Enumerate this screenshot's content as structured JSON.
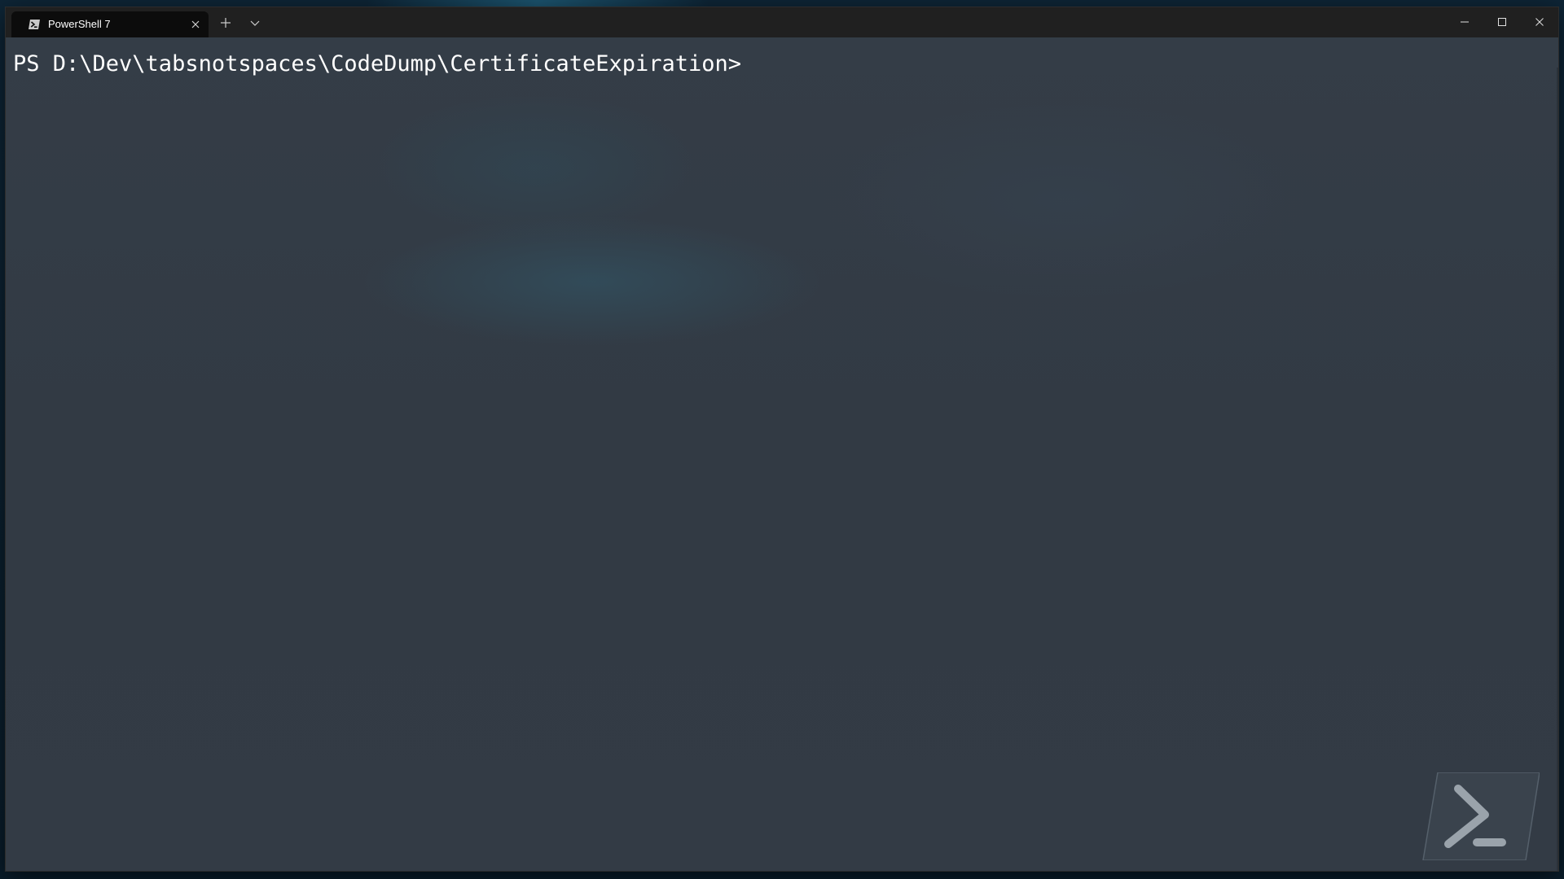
{
  "window": {
    "tab": {
      "title": "PowerShell 7",
      "icon": "powershell-icon",
      "close_icon": "close-icon"
    },
    "new_tab_icon": "plus-icon",
    "dropdown_icon": "chevron-down-icon",
    "controls": {
      "minimize_icon": "minimize-icon",
      "maximize_icon": "maximize-icon",
      "close_icon": "close-icon"
    }
  },
  "terminal": {
    "prompt": "PS D:\\Dev\\tabsnotspaces\\CodeDump\\CertificateExpiration>",
    "watermark_icon": "powershell-logo-icon"
  },
  "colors": {
    "titlebar": "#202020",
    "tab_active": "#0c0c0c",
    "terminal_background": "#333b45",
    "text": "#ffffff"
  }
}
